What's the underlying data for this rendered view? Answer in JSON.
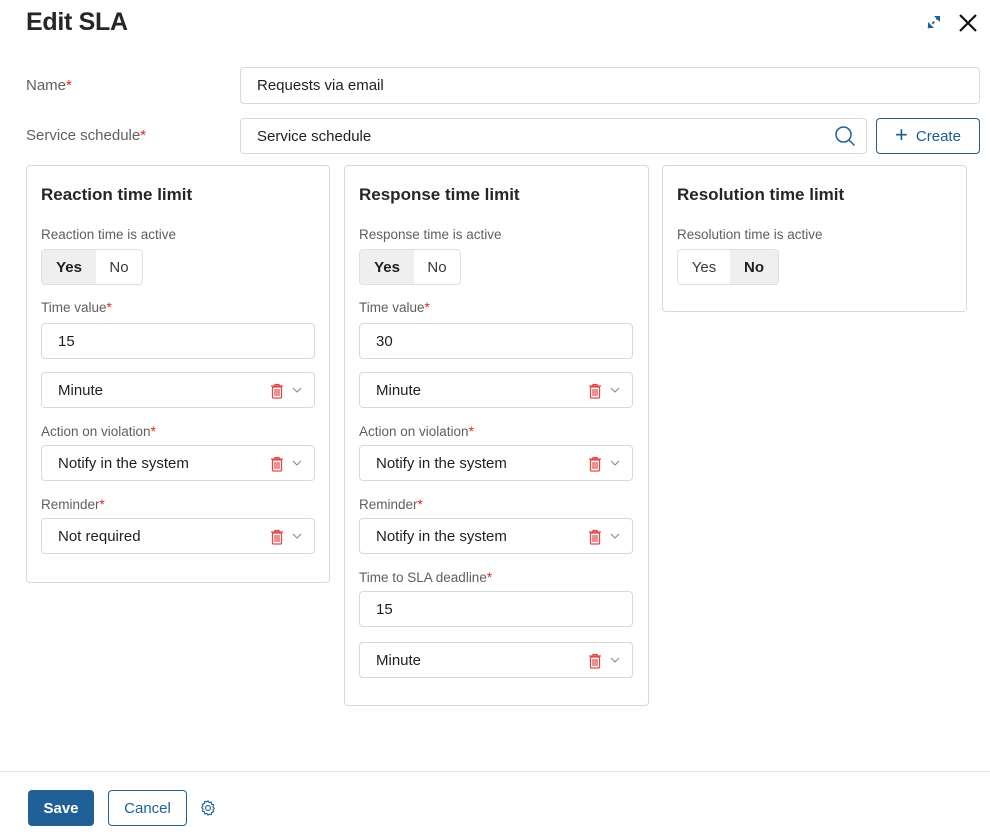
{
  "header": {
    "title": "Edit SLA",
    "expand_icon": "expand-arrows-icon",
    "close_icon": "close-icon"
  },
  "form": {
    "name": {
      "label": "Name",
      "required_mark": "*",
      "value": "Requests via email"
    },
    "service_schedule": {
      "label": "Service schedule",
      "required_mark": "*",
      "value": "Service schedule",
      "icon": "search-icon"
    },
    "create_button": {
      "label": "Create",
      "icon": "plus-icon"
    }
  },
  "cards": {
    "reaction": {
      "title": "Reaction time limit",
      "active_label": "Reaction time is active",
      "options": [
        "Yes",
        "No"
      ],
      "active_selected": "Yes",
      "time_value_label": "Time value",
      "time_value": "15",
      "time_unit": "Minute",
      "action_label": "Action on violation",
      "action_value": "Notify in the system",
      "reminder_label": "Reminder",
      "reminder_value": "Not required"
    },
    "response": {
      "title": "Response time limit",
      "active_label": "Response time is active",
      "options": [
        "Yes",
        "No"
      ],
      "active_selected": "Yes",
      "time_value_label": "Time value",
      "time_value": "30",
      "time_unit": "Minute",
      "action_label": "Action on violation",
      "action_value": "Notify in the system",
      "reminder_label": "Reminder",
      "reminder_value": "Notify in the system",
      "deadline_label": "Time to SLA deadline",
      "deadline_value": "15",
      "deadline_unit": "Minute"
    },
    "resolution": {
      "title": "Resolution time limit",
      "active_label": "Resolution time is active",
      "options": [
        "Yes",
        "No"
      ],
      "active_selected": "No"
    }
  },
  "required_mark": "*",
  "footer": {
    "save_label": "Save",
    "cancel_label": "Cancel",
    "settings_icon": "gear-icon"
  },
  "colors": {
    "primary": "#1f6196",
    "required": "#e02424",
    "delete_icon": "#e04848"
  }
}
